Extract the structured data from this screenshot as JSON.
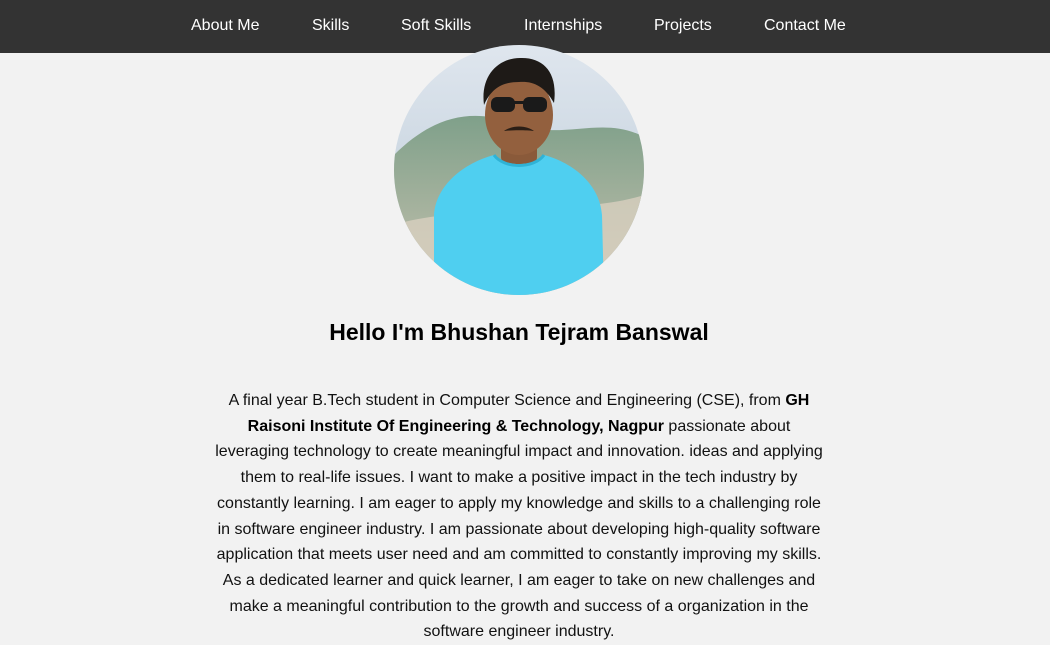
{
  "nav": {
    "items": [
      {
        "label": "About Me"
      },
      {
        "label": "Skills"
      },
      {
        "label": "Soft Skills"
      },
      {
        "label": "Internships"
      },
      {
        "label": "Projects"
      },
      {
        "label": "Contact Me"
      }
    ]
  },
  "profile": {
    "heading": "Hello I'm Bhushan Tejram Banswal",
    "bio_before": "A final year B.Tech student in Computer Science and Engineering (CSE), from ",
    "institution": "GH Raisoni Institute Of Engineering & Technology, Nagpur",
    "bio_after": " passionate about leveraging technology to create meaningful impact and innovation. ideas and applying them to real-life issues. I want to make a positive impact in the tech industry by constantly learning. I am eager to apply my knowledge and skills to a challenging role in software engineer industry. I am passionate about developing high-quality software application that meets user need and am committed to constantly improving my skills. As a dedicated learner and quick learner, I am eager to take on new challenges and make a meaningful contribution to the growth and success of a organization in the software engineer industry."
  },
  "colors": {
    "navbar_bg": "#333333",
    "page_bg": "#f2f2f2",
    "shirt": "#4fcff0"
  }
}
